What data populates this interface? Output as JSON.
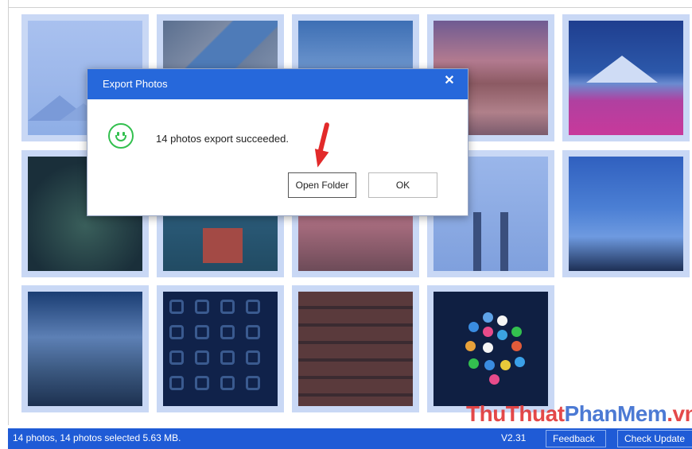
{
  "dialog": {
    "title": "Export Photos",
    "close_glyph": "✕",
    "message": "14 photos export succeeded.",
    "open_folder_label": "Open Folder",
    "ok_label": "OK"
  },
  "status_bar": {
    "summary": "14 photos, 14 photos selected 5.63 MB.",
    "version": "V2.31",
    "feedback_label": "Feedback",
    "check_update_label": "Check Update"
  },
  "watermark": {
    "part1": "ThuThuat",
    "part2": "PhanMem",
    "part3": ".vn"
  },
  "colors": {
    "accent": "#2668db",
    "status_bar": "#1f5bd6",
    "tile_border": "#c9d8f5",
    "success": "#33c04f",
    "arrow": "#e22a2a"
  },
  "icons": [
    "smile-icon",
    "close-icon",
    "arrow-annotation"
  ],
  "photo_count": 14
}
